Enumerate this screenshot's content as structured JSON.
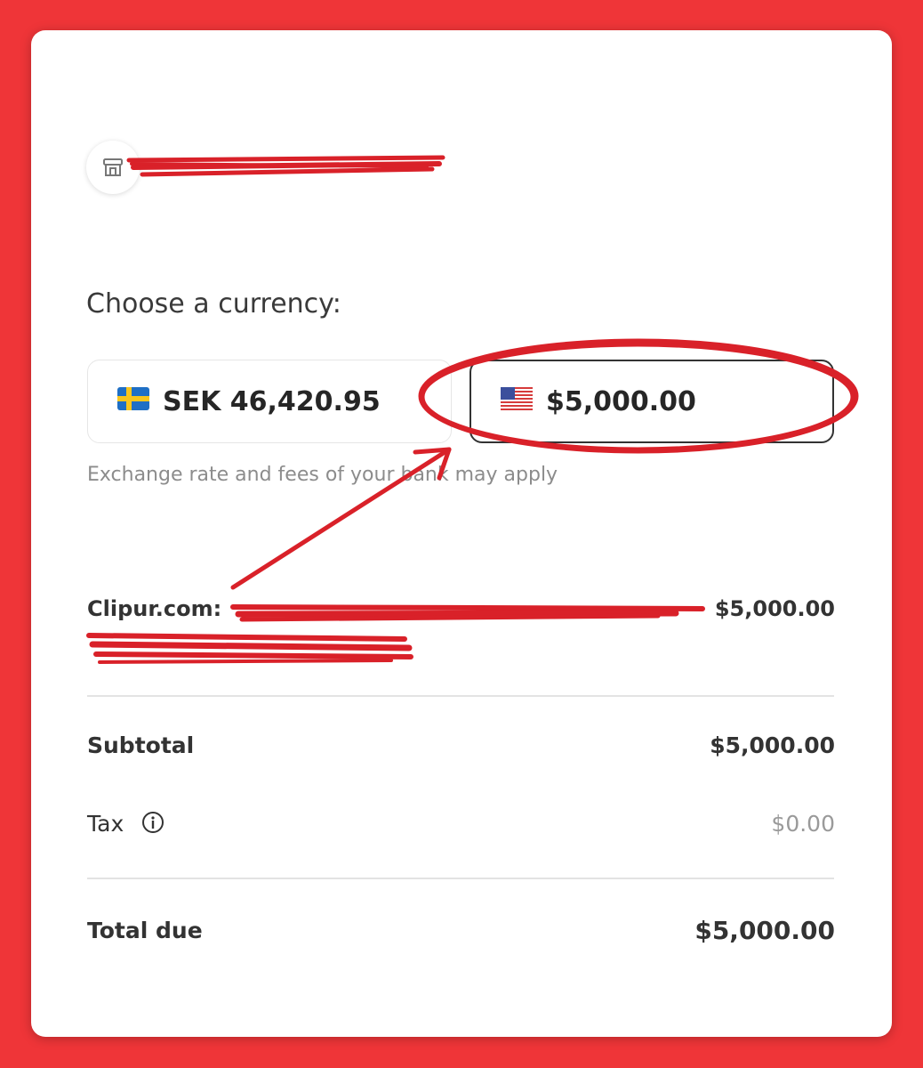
{
  "merchant": {
    "name": "",
    "logo_icon": "storefront-icon"
  },
  "currency": {
    "heading": "Choose a currency:",
    "options": [
      {
        "code": "SEK",
        "label": "SEK 46,420.95",
        "flag": "sweden-flag-icon",
        "selected": false
      },
      {
        "code": "USD",
        "label": "$5,000.00",
        "flag": "us-flag-icon",
        "selected": true
      }
    ],
    "note": "Exchange rate and fees of your bank may apply"
  },
  "line_item": {
    "title": "Clipur.com:",
    "amount": "$5,000.00"
  },
  "summary": {
    "subtotal_label": "Subtotal",
    "subtotal_value": "$5,000.00",
    "tax_label": "Tax",
    "tax_value": "$0.00",
    "total_label": "Total due",
    "total_value": "$5,000.00"
  },
  "colors": {
    "background": "#ef3538",
    "annotation": "#d92129",
    "selected_border": "#333333"
  }
}
